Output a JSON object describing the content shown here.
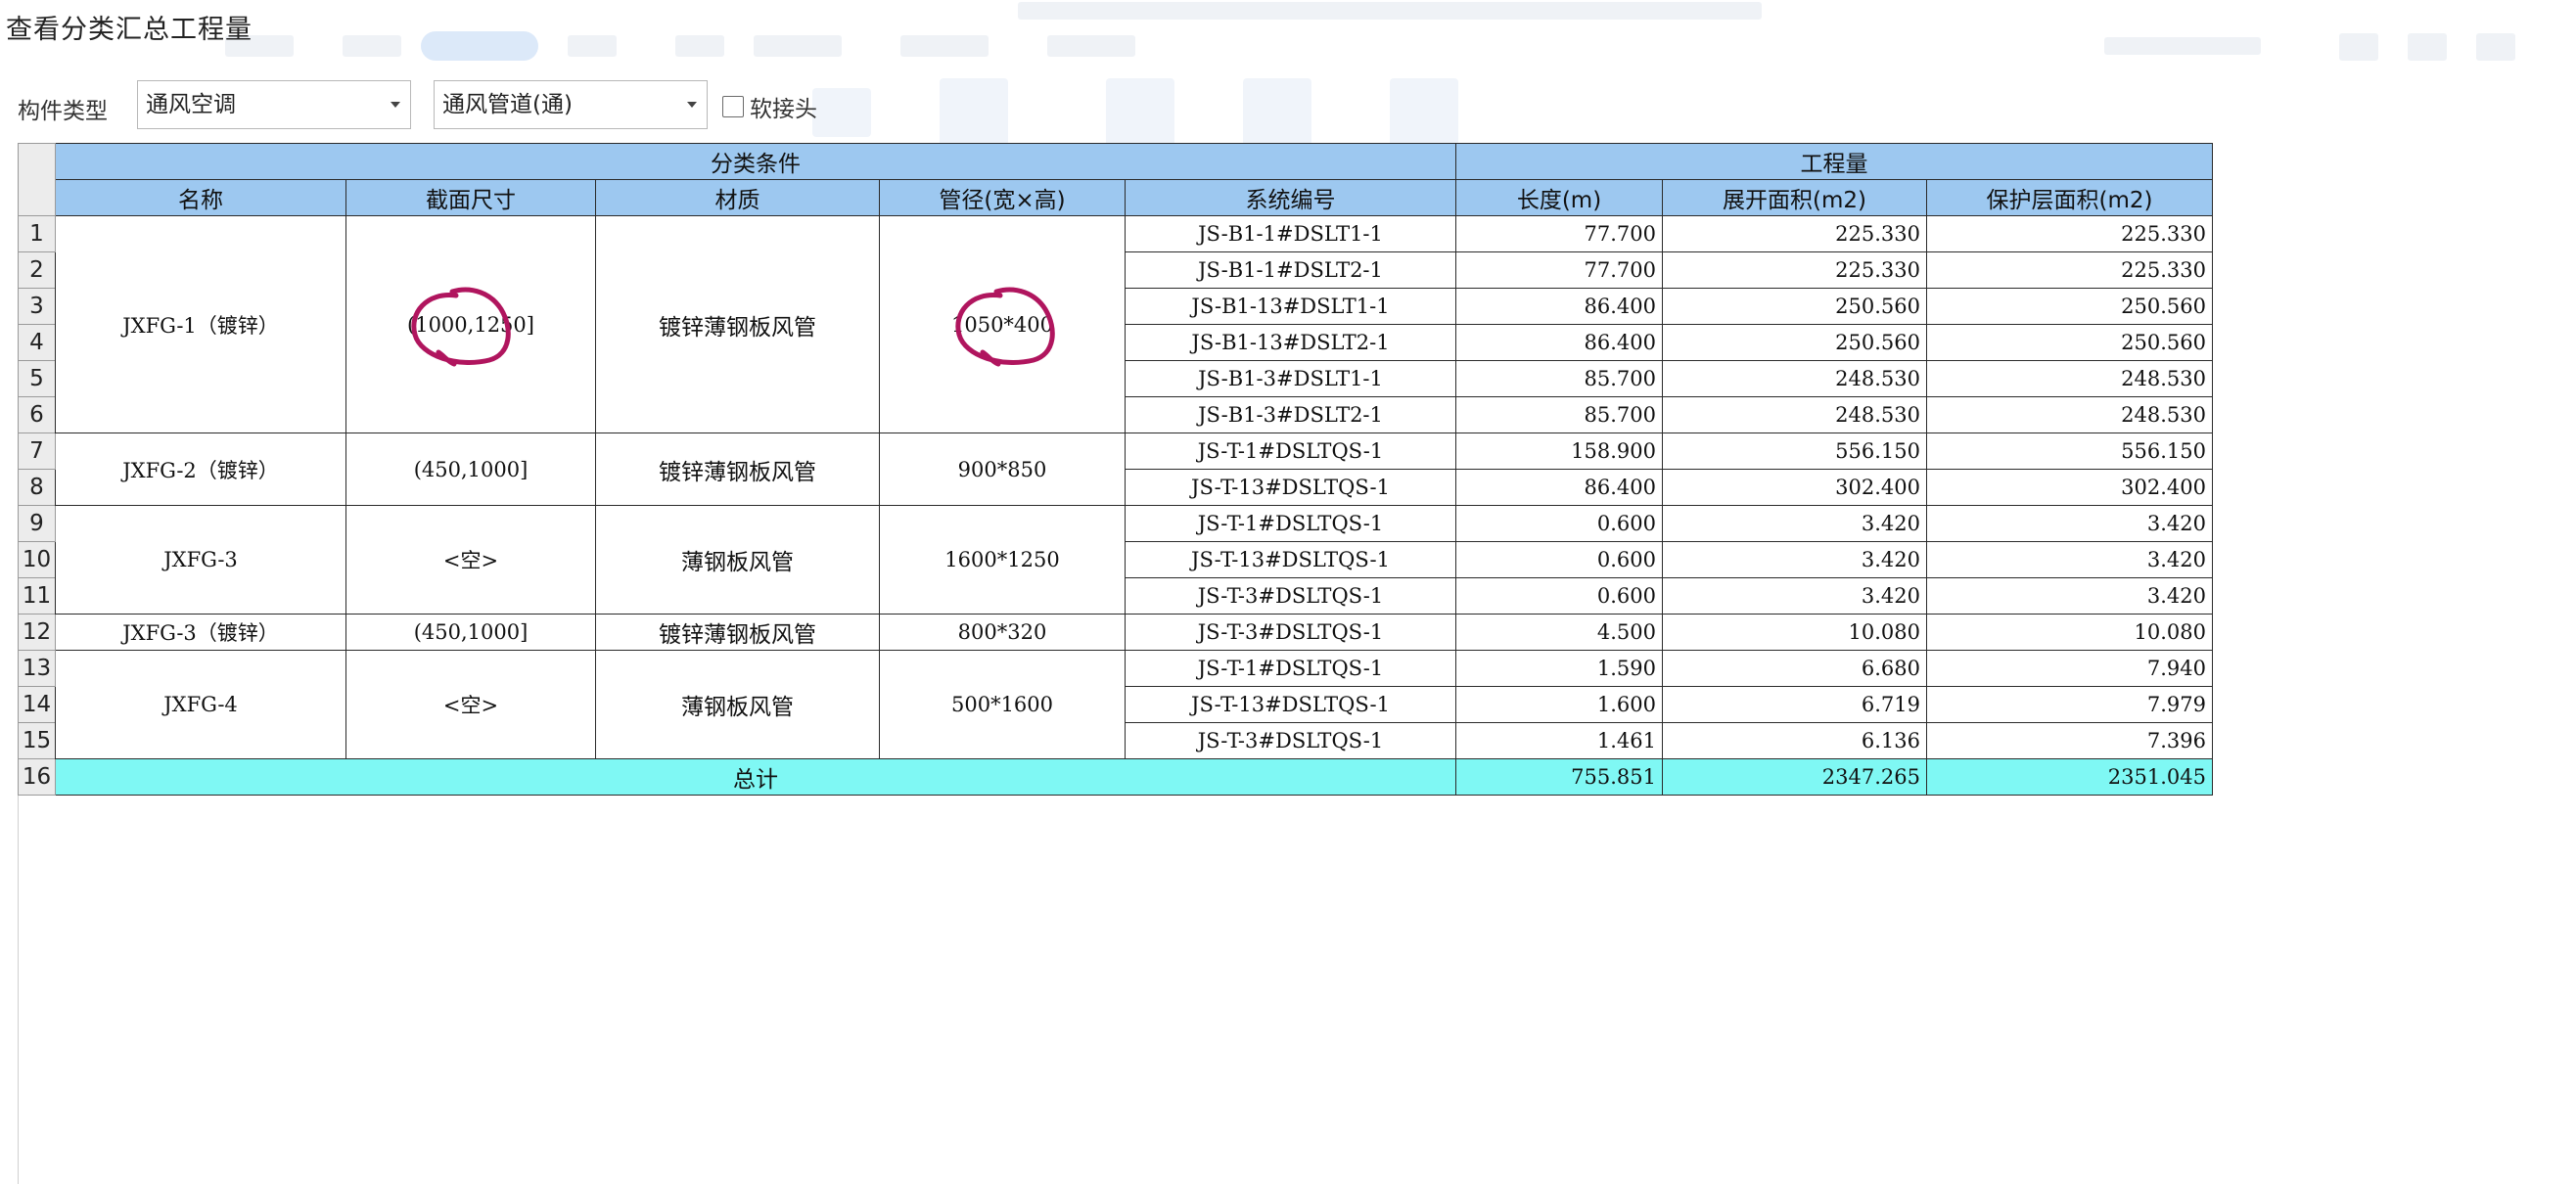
{
  "dialog": {
    "title": "查看分类汇总工程量"
  },
  "filters": {
    "type_label": "构件类型",
    "category_value": "通风空调",
    "subtype_value": "通风管道(通)",
    "checkbox_label": "软接头",
    "checkbox_checked": false
  },
  "table": {
    "group_headers": {
      "conditions": "分类条件",
      "quantities": "工程量"
    },
    "columns": [
      "名称",
      "截面尺寸",
      "材质",
      "管径(宽×高)",
      "系统编号",
      "长度(m)",
      "展开面积(m2)",
      "保护层面积(m2)"
    ],
    "groups": [
      {
        "name": "JXFG-1（镀锌）",
        "section": "(1000,1250]",
        "material": "镀锌薄钢板风管",
        "diameter": "1050*400",
        "circled": true,
        "rows": [
          {
            "n": "1",
            "system": "JS-B1-1#DSLT1-1",
            "length": "77.700",
            "area": "225.330",
            "protect": "225.330"
          },
          {
            "n": "2",
            "system": "JS-B1-1#DSLT2-1",
            "length": "77.700",
            "area": "225.330",
            "protect": "225.330"
          },
          {
            "n": "3",
            "system": "JS-B1-13#DSLT1-1",
            "length": "86.400",
            "area": "250.560",
            "protect": "250.560"
          },
          {
            "n": "4",
            "system": "JS-B1-13#DSLT2-1",
            "length": "86.400",
            "area": "250.560",
            "protect": "250.560"
          },
          {
            "n": "5",
            "system": "JS-B1-3#DSLT1-1",
            "length": "85.700",
            "area": "248.530",
            "protect": "248.530"
          },
          {
            "n": "6",
            "system": "JS-B1-3#DSLT2-1",
            "length": "85.700",
            "area": "248.530",
            "protect": "248.530"
          }
        ]
      },
      {
        "name": "JXFG-2（镀锌）",
        "section": "(450,1000]",
        "material": "镀锌薄钢板风管",
        "diameter": "900*850",
        "rows": [
          {
            "n": "7",
            "system": "JS-T-1#DSLTQS-1",
            "length": "158.900",
            "area": "556.150",
            "protect": "556.150"
          },
          {
            "n": "8",
            "system": "JS-T-13#DSLTQS-1",
            "length": "86.400",
            "area": "302.400",
            "protect": "302.400"
          }
        ]
      },
      {
        "name": "JXFG-3",
        "section": "<空>",
        "material": "薄钢板风管",
        "diameter": "1600*1250",
        "rows": [
          {
            "n": "9",
            "system": "JS-T-1#DSLTQS-1",
            "length": "0.600",
            "area": "3.420",
            "protect": "3.420"
          },
          {
            "n": "10",
            "system": "JS-T-13#DSLTQS-1",
            "length": "0.600",
            "area": "3.420",
            "protect": "3.420"
          },
          {
            "n": "11",
            "system": "JS-T-3#DSLTQS-1",
            "length": "0.600",
            "area": "3.420",
            "protect": "3.420"
          }
        ]
      },
      {
        "name": "JXFG-3（镀锌）",
        "section": "(450,1000]",
        "material": "镀锌薄钢板风管",
        "diameter": "800*320",
        "rows": [
          {
            "n": "12",
            "system": "JS-T-3#DSLTQS-1",
            "length": "4.500",
            "area": "10.080",
            "protect": "10.080"
          }
        ]
      },
      {
        "name": "JXFG-4",
        "section": "<空>",
        "material": "薄钢板风管",
        "diameter": "500*1600",
        "rows": [
          {
            "n": "13",
            "system": "JS-T-1#DSLTQS-1",
            "length": "1.590",
            "area": "6.680",
            "protect": "7.940"
          },
          {
            "n": "14",
            "system": "JS-T-13#DSLTQS-1",
            "length": "1.600",
            "area": "6.719",
            "protect": "7.979"
          },
          {
            "n": "15",
            "system": "JS-T-3#DSLTQS-1",
            "length": "1.461",
            "area": "6.136",
            "protect": "7.396"
          }
        ]
      }
    ],
    "total": {
      "n": "16",
      "label": "总计",
      "length": "755.851",
      "area": "2347.265",
      "protect": "2351.045"
    }
  },
  "colors": {
    "header_bg": "#9dc8f0",
    "total_bg": "#7ff8f4",
    "annotation": "#b0155e",
    "row_number_bg": "#ececec"
  }
}
